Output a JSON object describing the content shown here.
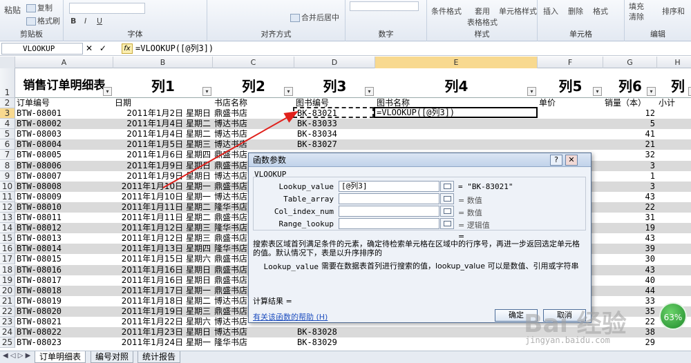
{
  "ribbon": {
    "paste": "粘贴",
    "copy": "复制",
    "format_painter": "格式刷",
    "clipboard_group": "剪贴板",
    "font_group": "字体",
    "align_group": "对齐方式",
    "merge_center": "合并后居中",
    "number_group": "数字",
    "conditional_format": "条件格式",
    "table_format": "套用\n表格格式",
    "cell_style": "单元格样式",
    "style_group": "样式",
    "insert": "插入",
    "delete": "删除",
    "format": "格式",
    "cells_group": "单元格",
    "fill": "填充",
    "clear": "清除",
    "sort_filter": "排序和",
    "edit_group": "编辑"
  },
  "formula_bar": {
    "name_box": "VLOOKUP",
    "cancel": "✕",
    "enter": "✓",
    "fx": "fx",
    "formula": "=VLOOKUP([@列3])"
  },
  "columns": [
    "A",
    "B",
    "C",
    "D",
    "E",
    "F",
    "G",
    "H"
  ],
  "selected_column": "E",
  "header_row": {
    "num": "1",
    "titles": [
      "销售订单明细表",
      "列1",
      "列2",
      "列3",
      "列4",
      "列5",
      "列6",
      "列"
    ]
  },
  "table_header": {
    "num": "2",
    "cells": [
      "订单编号",
      "日期",
      "书店名称",
      "图书编号",
      "图书名称",
      "单价",
      "销量（本）",
      "小计"
    ]
  },
  "rows": [
    {
      "n": "3",
      "id": "BTW-08001",
      "date": "2011年1月2日",
      "wd": "星期日",
      "store": "鼎盛书店",
      "book": "BK-83021",
      "qty": "12"
    },
    {
      "n": "4",
      "id": "BTW-08002",
      "date": "2011年1月4日",
      "wd": "星期二",
      "store": "博达书店",
      "book": "BK-83033",
      "qty": "5"
    },
    {
      "n": "5",
      "id": "BTW-08003",
      "date": "2011年1月4日",
      "wd": "星期二",
      "store": "博达书店",
      "book": "BK-83034",
      "qty": "41"
    },
    {
      "n": "6",
      "id": "BTW-08004",
      "date": "2011年1月5日",
      "wd": "星期三",
      "store": "博达书店",
      "book": "BK-83027",
      "qty": "21"
    },
    {
      "n": "7",
      "id": "BTW-08005",
      "date": "2011年1月6日",
      "wd": "星期四",
      "store": "鼎盛书店",
      "book": "",
      "qty": "32"
    },
    {
      "n": "8",
      "id": "BTW-08006",
      "date": "2011年1月9日",
      "wd": "星期日",
      "store": "鼎盛书店",
      "book": "",
      "qty": "3"
    },
    {
      "n": "9",
      "id": "BTW-08007",
      "date": "2011年1月9日",
      "wd": "星期日",
      "store": "博达书店",
      "book": "",
      "qty": "1"
    },
    {
      "n": "10",
      "id": "BTW-08008",
      "date": "2011年1月10日",
      "wd": "星期一",
      "store": "鼎盛书店",
      "book": "",
      "qty": "3"
    },
    {
      "n": "11",
      "id": "BTW-08009",
      "date": "2011年1月10日",
      "wd": "星期一",
      "store": "博达书店",
      "book": "",
      "qty": "43"
    },
    {
      "n": "12",
      "id": "BTW-08010",
      "date": "2011年1月11日",
      "wd": "星期二",
      "store": "隆华书店",
      "book": "",
      "qty": "22"
    },
    {
      "n": "13",
      "id": "BTW-08011",
      "date": "2011年1月11日",
      "wd": "星期二",
      "store": "鼎盛书店",
      "book": "",
      "qty": "31"
    },
    {
      "n": "14",
      "id": "BTW-08012",
      "date": "2011年1月12日",
      "wd": "星期三",
      "store": "隆华书店",
      "book": "",
      "qty": "19"
    },
    {
      "n": "15",
      "id": "BTW-08013",
      "date": "2011年1月12日",
      "wd": "星期三",
      "store": "鼎盛书店",
      "book": "",
      "qty": "43"
    },
    {
      "n": "16",
      "id": "BTW-08014",
      "date": "2011年1月13日",
      "wd": "星期四",
      "store": "隆华书店",
      "book": "",
      "qty": "39"
    },
    {
      "n": "17",
      "id": "BTW-08015",
      "date": "2011年1月15日",
      "wd": "星期六",
      "store": "鼎盛书店",
      "book": "",
      "qty": "30"
    },
    {
      "n": "18",
      "id": "BTW-08016",
      "date": "2011年1月16日",
      "wd": "星期日",
      "store": "鼎盛书店",
      "book": "",
      "qty": "43"
    },
    {
      "n": "19",
      "id": "BTW-08017",
      "date": "2011年1月16日",
      "wd": "星期日",
      "store": "鼎盛书店",
      "book": "",
      "qty": "40"
    },
    {
      "n": "20",
      "id": "BTW-08018",
      "date": "2011年1月17日",
      "wd": "星期一",
      "store": "鼎盛书店",
      "book": "",
      "qty": "44"
    },
    {
      "n": "21",
      "id": "BTW-08019",
      "date": "2011年1月18日",
      "wd": "星期二",
      "store": "博达书店",
      "book": "",
      "qty": "33"
    },
    {
      "n": "22",
      "id": "BTW-08020",
      "date": "2011年1月19日",
      "wd": "星期三",
      "store": "鼎盛书店",
      "book": "",
      "qty": "35"
    },
    {
      "n": "23",
      "id": "BTW-08021",
      "date": "2011年1月22日",
      "wd": "星期六",
      "store": "博达书店",
      "book": "",
      "qty": "22"
    },
    {
      "n": "24",
      "id": "BTW-08022",
      "date": "2011年1月23日",
      "wd": "星期日",
      "store": "博达书店",
      "book": "BK-83028",
      "qty": "38"
    },
    {
      "n": "25",
      "id": "BTW-08023",
      "date": "2011年1月24日",
      "wd": "星期一",
      "store": "隆华书店",
      "book": "BK-83029",
      "qty": "29"
    }
  ],
  "active_cell_text": "=VLOOKUP([@列3])",
  "dialog": {
    "title": "函数参数",
    "help_btn": "?",
    "close_btn": "✕",
    "function": "VLOOKUP",
    "params": [
      {
        "label": "Lookup_value",
        "value": "[@列3]",
        "result": "= \"BK-83021\""
      },
      {
        "label": "Table_array",
        "value": "",
        "result": "= 数值"
      },
      {
        "label": "Col_index_num",
        "value": "",
        "result": "= 数值"
      },
      {
        "label": "Range_lookup",
        "value": "",
        "result": "= 逻辑值"
      }
    ],
    "equals": "=",
    "description": "搜索表区域首列满足条件的元素，确定待检索单元格在区域中的行序号，再进一步返回选定单元格的值。默认情况下，表是以升序排序的",
    "param_name": "Lookup_value",
    "param_desc": "需要在数据表首列进行搜索的值，lookup_value 可以是数值、引用或字符串",
    "calc_result": "计算结果 =",
    "help_link": "有关该函数的帮助 (H)",
    "ok": "确定",
    "cancel": "取消"
  },
  "sheet_tabs": [
    "订单明细表",
    "编号对照",
    "统计报告"
  ],
  "badge": "63%",
  "watermark": "Bai 经验",
  "watermark_url": "jingyan.baidu.com"
}
